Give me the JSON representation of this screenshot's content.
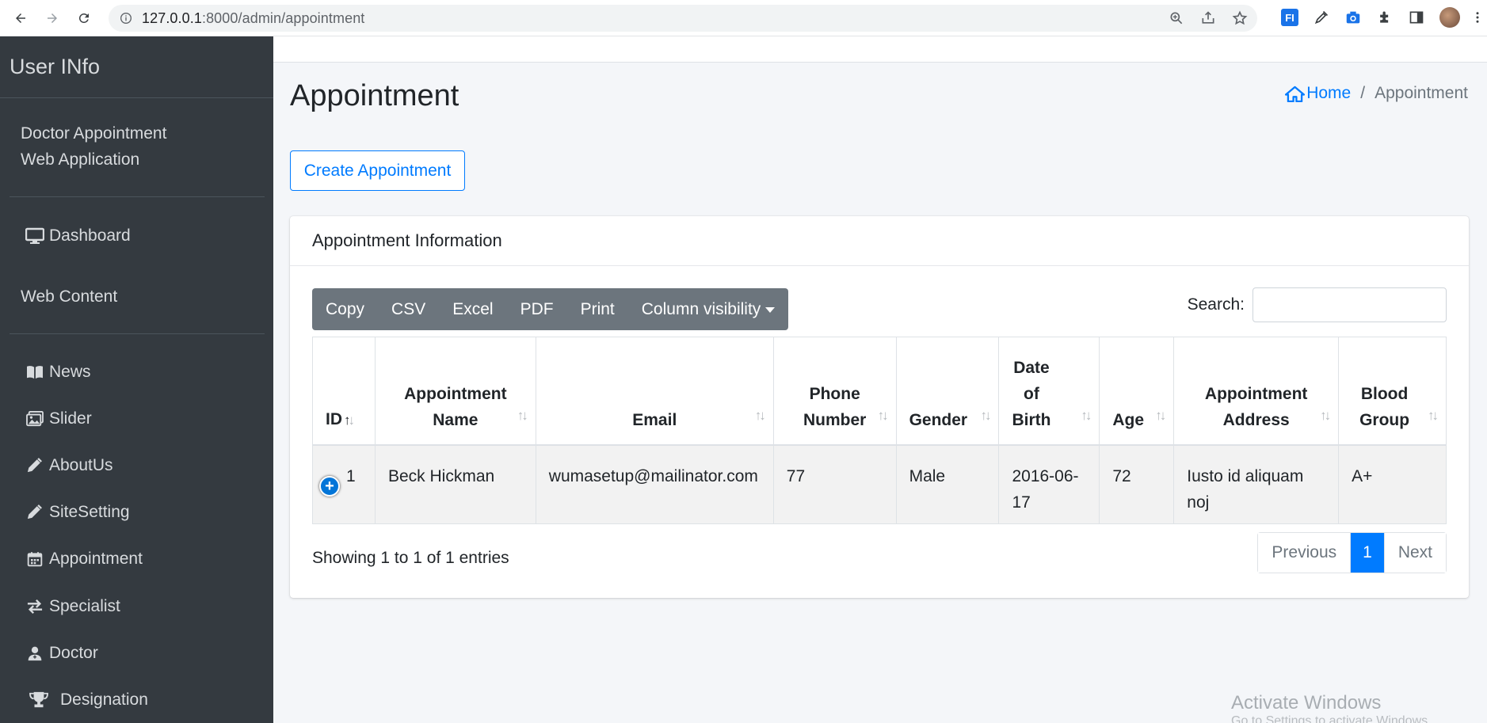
{
  "browser": {
    "url_host": "127.0.0.1",
    "url_rest": ":8000/admin/appointment",
    "ext_fi": "FI"
  },
  "sidebar": {
    "brand": "User INfo",
    "user_line1": "Doctor Appointment",
    "user_line2": "Web Application",
    "items": [
      {
        "label": "Dashboard",
        "icon": "desktop-icon"
      },
      {
        "label": "Web Content",
        "icon": ""
      },
      {
        "label": "News",
        "icon": "book-icon"
      },
      {
        "label": "Slider",
        "icon": "images-icon"
      },
      {
        "label": "AboutUs",
        "icon": "pencil-icon"
      },
      {
        "label": "SiteSetting",
        "icon": "pencil-icon"
      },
      {
        "label": "Appointment",
        "icon": "calendar-icon"
      },
      {
        "label": "Specialist",
        "icon": "exchange-icon"
      },
      {
        "label": "Doctor",
        "icon": "user-doctor-icon"
      },
      {
        "label": "Designation",
        "icon": "trophy-icon"
      }
    ]
  },
  "header": {
    "title": "Appointment",
    "breadcrumb_home": "Home",
    "breadcrumb_sep": "/",
    "breadcrumb_current": "Appointment"
  },
  "actions": {
    "create_label": "Create Appointment"
  },
  "card": {
    "title": "Appointment Information",
    "buttons": [
      "Copy",
      "CSV",
      "Excel",
      "PDF",
      "Print",
      "Column visibility"
    ],
    "search_label": "Search:",
    "search_value": ""
  },
  "table": {
    "columns": [
      [
        "ID"
      ],
      [
        "Appointment",
        "Name"
      ],
      [
        "Email"
      ],
      [
        "Phone",
        "Number"
      ],
      [
        "Gender"
      ],
      [
        "Date",
        "of",
        "Birth"
      ],
      [
        "Age"
      ],
      [
        "Appointment",
        "Address"
      ],
      [
        "Blood",
        "Group"
      ]
    ],
    "rows": [
      {
        "cells": [
          [
            "1"
          ],
          [
            "Beck Hickman"
          ],
          [
            "wumasetup@mailinator.com"
          ],
          [
            "77"
          ],
          [
            "Male"
          ],
          [
            "2016-06-",
            "17"
          ],
          [
            "72"
          ],
          [
            "Iusto id aliquam",
            "noj"
          ],
          [
            "A+"
          ]
        ]
      }
    ],
    "expand_symbol": "+"
  },
  "footer": {
    "info": "Showing 1 to 1 of 1 entries",
    "prev": "Previous",
    "page": "1",
    "next": "Next"
  },
  "watermark": {
    "line1": "Activate Windows",
    "line2": "Go to Settings to activate Windows."
  },
  "colors": {
    "sidebar_bg": "#343a40",
    "accent": "#007bff",
    "dt_buttons_bg": "#6c757d",
    "content_bg": "#f4f6f9"
  }
}
